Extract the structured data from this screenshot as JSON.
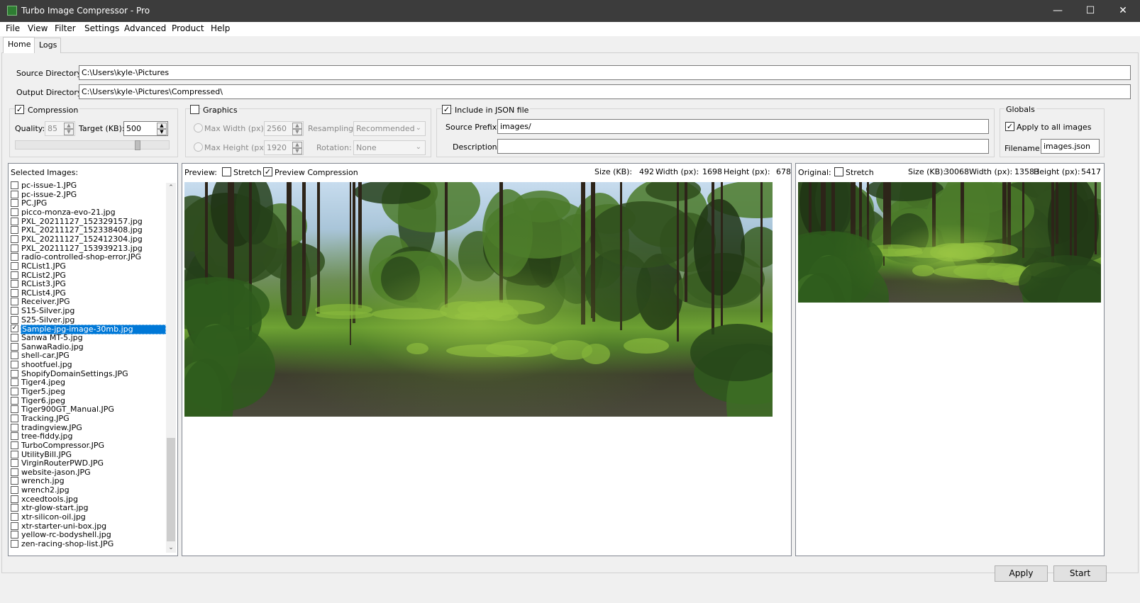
{
  "window": {
    "title": "Turbo Image Compressor - Pro",
    "controls": [
      "minimize-icon",
      "maximize-icon",
      "close-icon"
    ]
  },
  "menu": [
    "File",
    "View",
    "Filter",
    "Settings",
    "Advanced",
    "Product",
    "Help"
  ],
  "tabs": [
    "Home",
    "Logs"
  ],
  "directories": {
    "source_label": "Source Directory:",
    "source_value": "C:\\Users\\kyle-\\Pictures",
    "output_label": "Output Directory:",
    "output_value": "C:\\Users\\kyle-\\Pictures\\Compressed\\"
  },
  "compression": {
    "label": "Compression",
    "checked": true,
    "quality_label": "Quality:",
    "quality_value": "85",
    "target_label": "Target (KB):",
    "target_value": "500",
    "slider_fraction": 0.8
  },
  "graphics": {
    "label": "Graphics",
    "checked": false,
    "max_width_label": "Max Width  (px):",
    "max_width_value": "2560",
    "max_height_label": "Max Height  (px):",
    "max_height_value": "1920",
    "resampling_label": "Resampling:",
    "resampling_value": "Recommended",
    "rotation_label": "Rotation:",
    "rotation_value": "None"
  },
  "json": {
    "label": "Include in JSON file",
    "checked": true,
    "source_prefix_label": "Source Prefix:",
    "source_prefix_value": "images/",
    "description_label": "Description:",
    "description_value": ""
  },
  "globals": {
    "label": "Globals",
    "apply_all_label": "Apply to all images",
    "apply_all_checked": true,
    "filename_label": "Filename:",
    "filename_value": "images.json"
  },
  "image_list": {
    "label": "Selected Images:",
    "items": [
      {
        "name": "pc-issue-1.JPG",
        "checked": false
      },
      {
        "name": "pc-issue-2.JPG",
        "checked": false
      },
      {
        "name": "PC.JPG",
        "checked": false
      },
      {
        "name": "picco-monza-evo-21.jpg",
        "checked": false
      },
      {
        "name": "PXL_20211127_152329157.jpg",
        "checked": false
      },
      {
        "name": "PXL_20211127_152338408.jpg",
        "checked": false
      },
      {
        "name": "PXL_20211127_152412304.jpg",
        "checked": false
      },
      {
        "name": "PXL_20211127_153939213.jpg",
        "checked": false
      },
      {
        "name": "radio-controlled-shop-error.JPG",
        "checked": false
      },
      {
        "name": "RCList1.JPG",
        "checked": false
      },
      {
        "name": "RCList2.JPG",
        "checked": false
      },
      {
        "name": "RCList3.JPG",
        "checked": false
      },
      {
        "name": "RCList4.JPG",
        "checked": false
      },
      {
        "name": "Receiver.JPG",
        "checked": false
      },
      {
        "name": "S15-Silver.jpg",
        "checked": false
      },
      {
        "name": "S25-Silver.jpg",
        "checked": false
      },
      {
        "name": "Sample-jpg-image-30mb.jpg",
        "checked": true,
        "selected": true
      },
      {
        "name": "Sanwa MT-5.jpg",
        "checked": false
      },
      {
        "name": "SanwaRadio.jpg",
        "checked": false
      },
      {
        "name": "shell-car.JPG",
        "checked": false
      },
      {
        "name": "shootfuel.jpg",
        "checked": false
      },
      {
        "name": "ShopifyDomainSettings.JPG",
        "checked": false
      },
      {
        "name": "Tiger4.jpeg",
        "checked": false
      },
      {
        "name": "Tiger5.jpeg",
        "checked": false
      },
      {
        "name": "Tiger6.jpeg",
        "checked": false
      },
      {
        "name": "Tiger900GT_Manual.JPG",
        "checked": false
      },
      {
        "name": "Tracking.JPG",
        "checked": false
      },
      {
        "name": "tradingview.JPG",
        "checked": false
      },
      {
        "name": "tree-fiddy.jpg",
        "checked": false
      },
      {
        "name": "TurboCompressor.JPG",
        "checked": false
      },
      {
        "name": "UtilityBill.JPG",
        "checked": false
      },
      {
        "name": "VirginRouterPWD.JPG",
        "checked": false
      },
      {
        "name": "website-jason.JPG",
        "checked": false
      },
      {
        "name": "wrench.jpg",
        "checked": false
      },
      {
        "name": "wrench2.jpg",
        "checked": false
      },
      {
        "name": "xceedtools.jpg",
        "checked": false
      },
      {
        "name": "xtr-glow-start.jpg",
        "checked": false
      },
      {
        "name": "xtr-silicon-oil.jpg",
        "checked": false
      },
      {
        "name": "xtr-starter-uni-box.jpg",
        "checked": false
      },
      {
        "name": "yellow-rc-bodyshell.jpg",
        "checked": false
      },
      {
        "name": "zen-racing-shop-list.JPG",
        "checked": false
      }
    ]
  },
  "preview": {
    "label": "Preview:",
    "stretch_label": "Stretch",
    "stretch_checked": false,
    "preview_compression_label": "Preview Compression",
    "preview_compression_checked": true,
    "size_label": "Size (KB):",
    "size_value": "492",
    "width_label": "Width (px):",
    "width_value": "1698",
    "height_label": "Height (px):",
    "height_value": "678"
  },
  "original": {
    "label": "Original:",
    "stretch_label": "Stretch",
    "stretch_checked": false,
    "size_label": "Size (KB):",
    "size_value": "30068",
    "width_label": "Width (px):",
    "width_value": "13583",
    "height_label": "Height (px):",
    "height_value": "5417"
  },
  "buttons": {
    "apply": "Apply",
    "start": "Start"
  },
  "colors": {
    "titlebar": "#3c3c3c",
    "selection": "#0078d7"
  }
}
